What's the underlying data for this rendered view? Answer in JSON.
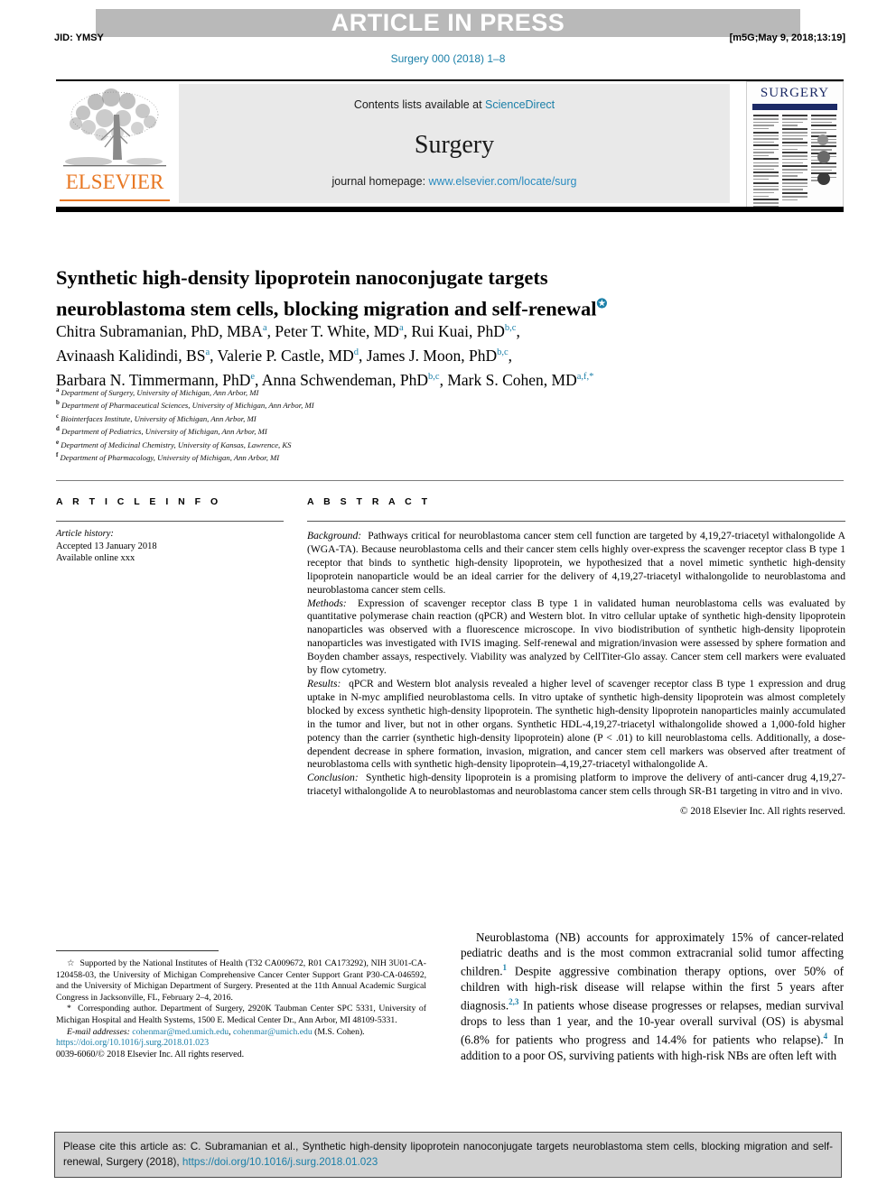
{
  "banner": {
    "press_label": "ARTICLE IN PRESS",
    "jid": "JID: YMSY",
    "stamp": "[m5G;May 9, 2018;13:19]",
    "journal_ref": "Surgery 000 (2018) 1–8"
  },
  "masthead": {
    "contents_prefix": "Contents lists available at ",
    "sciencedirect": "ScienceDirect",
    "journal_name": "Surgery",
    "homepage_prefix": "journal homepage: ",
    "homepage_url": "www.elsevier.com/locate/surg",
    "publisher": "ELSEVIER",
    "cover_title": "SURGERY"
  },
  "article": {
    "title_line1": "Synthetic high-density lipoprotein nanoconjugate targets",
    "title_line2": "neuroblastoma stem cells, blocking migration and self-renewal",
    "title_marker": "✪",
    "authors_line1": "Chitra Subramanian, PhD, MBA<sup>a</sup>, Peter T. White, MD<sup>a</sup>, Rui Kuai, PhD<sup>b,c</sup>,",
    "authors_line2": "Avinaash Kalidindi, BS<sup>a</sup>, Valerie P. Castle, MD<sup>d</sup>, James J. Moon, PhD<sup>b,c</sup>,",
    "authors_line3": "Barbara N. Timmermann, PhD<sup>e</sup>, Anna Schwendeman, PhD<sup>b,c</sup>, Mark S. Cohen, MD<sup>a,f,</sup><sup>*</sup>",
    "affiliations": [
      "<sup>a</sup> Department of Surgery, University of Michigan, Ann Arbor, MI",
      "<sup>b</sup> Department of Pharmaceutical Sciences, University of Michigan, Ann Arbor, MI",
      "<sup>c</sup> Biointerfaces Institute, University of Michigan, Ann Arbor, MI",
      "<sup>d</sup> Department of Pediatrics, University of Michigan, Ann Arbor, MI",
      "<sup>e</sup> Department of Medicinal Chemistry, University of Kansas, Lawrence, KS",
      "<sup>f</sup> Department of Pharmacology, University of Michigan, Ann Arbor, MI"
    ]
  },
  "article_info": {
    "heading": "A R T I C L E   I N F O",
    "history_label": "Article history:",
    "accepted": "Accepted 13 January 2018",
    "available": "Available online xxx"
  },
  "abstract": {
    "heading": "A B S T R A C T",
    "background_label": "Background:",
    "background_text": "Pathways critical for neuroblastoma cancer stem cell function are targeted by 4,19,27-triacetyl withalongolide A (WGA-TA). Because neuroblastoma cells and their cancer stem cells highly over-express the scavenger receptor class B type 1 receptor that binds to synthetic high-density lipoprotein, we hypothesized that a novel mimetic synthetic high-density lipoprotein nanoparticle would be an ideal carrier for the delivery of 4,19,27-triacetyl withalongolide to neuroblastoma and neuroblastoma cancer stem cells.",
    "methods_label": "Methods:",
    "methods_text": "Expression of scavenger receptor class B type 1 in validated human neuroblastoma cells was evaluated by quantitative polymerase chain reaction (qPCR) and Western blot. In vitro cellular uptake of synthetic high-density lipoprotein nanoparticles was observed with a fluorescence microscope. In vivo biodistribution of synthetic high-density lipoprotein nanoparticles was investigated with IVIS imaging. Self-renewal and migration/invasion were assessed by sphere formation and Boyden chamber assays, respectively. Viability was analyzed by CellTiter-Glo assay. Cancer stem cell markers were evaluated by flow cytometry.",
    "results_label": "Results:",
    "results_text": "qPCR and Western blot analysis revealed a higher level of scavenger receptor class B type 1 expression and drug uptake in N-myc amplified neuroblastoma cells. In vitro uptake of synthetic high-density lipoprotein was almost completely blocked by excess synthetic high-density lipoprotein. The synthetic high-density lipoprotein nanoparticles mainly accumulated in the tumor and liver, but not in other organs. Synthetic HDL-4,19,27-triacetyl withalongolide showed a 1,000-fold higher potency than the carrier (synthetic high-density lipoprotein) alone (P < .01) to kill neuroblastoma cells. Additionally, a dose-dependent decrease in sphere formation, invasion, migration, and cancer stem cell markers was observed after treatment of neuroblastoma cells with synthetic high-density lipoprotein–4,19,27-triacetyl withalongolide A.",
    "conclusion_label": "Conclusion:",
    "conclusion_text": "Synthetic high-density lipoprotein is a promising platform to improve the delivery of anti-cancer drug 4,19,27-triacetyl withalongolide A to neuroblastomas and neuroblastoma cancer stem cells through SR-B1 targeting in vitro and in vivo.",
    "copyright": "© 2018 Elsevier Inc. All rights reserved."
  },
  "footnotes": {
    "funding": "Supported by the National Institutes of Health (T32 CA009672, R01 CA173292), NIH 3U01-CA-120458-03, the University of Michigan Comprehensive Cancer Center Support Grant P30-CA-046592, and the University of Michigan Department of Surgery. Presented at the 11th Annual Academic Surgical Congress in Jacksonville, FL, February 2–4, 2016.",
    "corresponding": "Corresponding author. Department of Surgery, 2920K Taubman Center SPC 5331, University of Michigan Hospital and Health Systems, 1500 E. Medical Center Dr., Ann Arbor, MI 48109-5331.",
    "email_label": "E-mail addresses:",
    "email1": "cohenmar@med.umich.edu",
    "email2": "cohenmar@umich.edu",
    "email_suffix": "(M.S. Cohen).",
    "doi": "https://doi.org/10.1016/j.surg.2018.01.023",
    "issn": "0039-6060/© 2018 Elsevier Inc. All rights reserved."
  },
  "intro": {
    "paragraph": "Neuroblastoma (NB) accounts for approximately 15% of cancer-related pediatric deaths and is the most common extracranial solid tumor affecting children.<sup>1</sup> Despite aggressive combination therapy options, over 50% of children with high-risk disease will relapse within the first 5 years after diagnosis.<sup>2,3</sup> In patients whose disease progresses or relapses, median survival drops to less than 1 year, and the 10-year overall survival (OS) is abysmal (6.8% for patients who progress and 14.4% for patients who relapse).<sup>4</sup> In addition to a poor OS, surviving patients with high-risk NBs are often left with"
  },
  "cite": {
    "text_before_link": "Please cite this article as: C. Subramanian et al., Synthetic high-density lipoprotein nanoconjugate targets neuroblastoma stem cells, blocking migration and self-renewal, Surgery (2018), ",
    "link": "https://doi.org/10.1016/j.surg.2018.01.023"
  },
  "colors": {
    "link": "#1a7fa8",
    "banner_band": "#b9b9b9",
    "elsevier_orange": "#e87722",
    "cover_navy": "#1c2a66",
    "cite_box_bg": "#d2d2d2"
  }
}
